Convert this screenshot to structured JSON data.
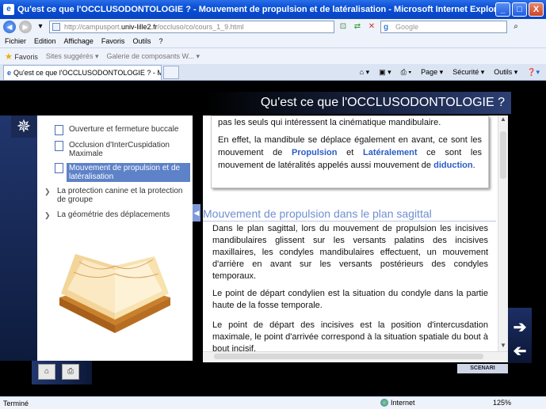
{
  "window": {
    "title": "Qu'est ce que l'OCCLUSODONTOLOGIE ? - Mouvement de propulsion et de latéralisation - Microsoft Internet Explorer",
    "buttons": [
      "_",
      "□",
      "X"
    ]
  },
  "address": {
    "url_prefix": "http://campusport.",
    "url_domain": "univ-lille2.fr",
    "url_suffix": "/occluso/co/cours_1_9.html",
    "search_placeholder": "Google"
  },
  "menu": [
    "Fichier",
    "Edition",
    "Affichage",
    "Favoris",
    "Outils",
    "?"
  ],
  "favorites": {
    "label": "Favoris",
    "items": [
      "Sites suggérés ▾",
      "Galerie de composants W... ▾"
    ]
  },
  "tab": {
    "label": "Qu'est ce que l'OCCLUSODONTOLOGIE ? - Mouvemen...",
    "commands": [
      "Page ▾",
      "Sécurité ▾",
      "Outils ▾"
    ]
  },
  "page": {
    "header": "Qu'est ce que l'OCCLUSODONTOLOGIE ?",
    "nav": [
      {
        "label": "Ouverture et fermeture buccale"
      },
      {
        "label": "Occlusion d'InterCuspidation Maximale"
      },
      {
        "label": "Mouvement de propulsion et de latéralisation"
      },
      {
        "label": "La protection canine et la protection de groupe"
      },
      {
        "label": "La géométrie des déplacements"
      }
    ],
    "box_text1": "pas les seuls qui intéressent la cinématique mandibulaire.",
    "box_text2_a": "En effet, la mandibule se déplace également en avant, ce sont les mouvement de ",
    "box_propulsion": "Propulsion",
    "box_and": " et ",
    "box_lateral": "Latéralement",
    "box_text2_b": " ce sont les mouvement de latéralités appelés aussi mouvement de ",
    "box_diduction": "diduction",
    "box_end": ".",
    "section_title": "Mouvement de propulsion dans le plan sagittal",
    "para1": "Dans le plan sagittal, lors du mouvement de propulsion les incisives mandibulaires glissent sur les versants palatins des incisives maxillaires, les condyles mandibulaires effectuent, un mouvement d'arrière en avant sur les versants postérieurs des condyles temporaux.",
    "para2": "Le point de départ condylien est la situation du condyle dans la partie haute de la fosse temporale.",
    "para3": "Le point de départ des incisives est la position d'intercusdation maximale, le point d'arrivée correspond à la situation spatiale du bout à bout incisif.",
    "scenari": "SCENARI"
  },
  "status": {
    "left": "Terminé",
    "zone": "Internet",
    "zoom": "125%"
  }
}
